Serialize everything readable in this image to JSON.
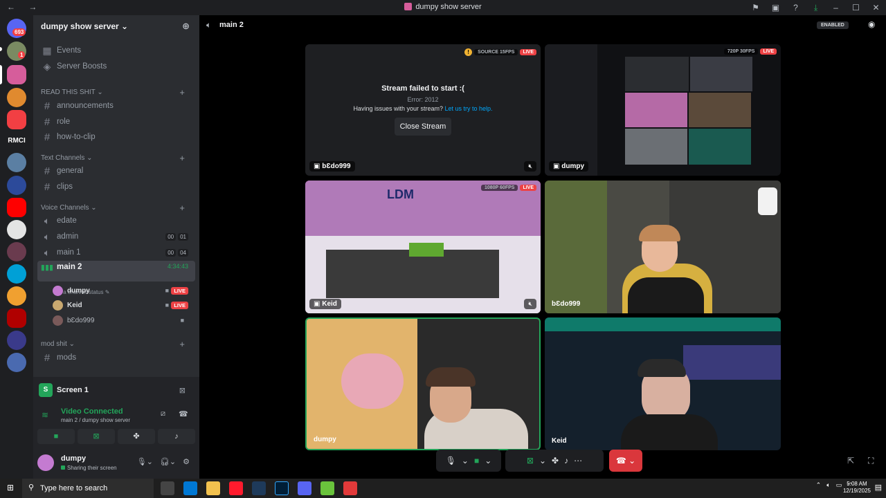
{
  "window": {
    "title": "dumpy show server",
    "nav": "← →"
  },
  "titlebar_icons": [
    "inbox-icon",
    "screen-icon",
    "help-icon",
    "download-icon"
  ],
  "guilds": {
    "home_badge": "693",
    "dm_badge": "1",
    "text_guild": "RMCI"
  },
  "server": {
    "name": "dumpy show server ⌄"
  },
  "sidebar": {
    "top_items": [
      {
        "label": "Events"
      },
      {
        "label": "Server Boosts"
      }
    ],
    "categories": {
      "read": "READ THIS SHIT ⌄",
      "text": "Text Channels ⌄",
      "voice": "Voice Channels ⌄",
      "mod": "mod shit ⌄"
    },
    "read_channels": [
      "announcements",
      "role",
      "how-to-clip"
    ],
    "text_channels": [
      "general",
      "clips"
    ],
    "voice_channels": [
      {
        "name": "edate"
      },
      {
        "name": "admin",
        "counts": [
          "00",
          "01"
        ]
      },
      {
        "name": "main 1",
        "counts": [
          "00",
          "04"
        ]
      },
      {
        "name": "main 2",
        "timer": "4:34:43",
        "status": "Set a channel status"
      }
    ],
    "voice_users": [
      {
        "name": "dumpy",
        "live": "LIVE"
      },
      {
        "name": "Keid",
        "live": "LIVE"
      },
      {
        "name": "bƐdo999",
        "live": ""
      }
    ],
    "mod_channels": [
      "mods"
    ]
  },
  "panel": {
    "screen_label": "Screen 1",
    "connection": "Video Connected",
    "location": "main 2 / dumpy show server",
    "user_name": "dumpy",
    "user_status": "Sharing their screen"
  },
  "main": {
    "channel": "main 2",
    "enabled_badge": "ENABLED",
    "tiles": [
      {
        "name": "bƐdo999",
        "quality": "SOURCE 15FPS",
        "live": "LIVE",
        "error_title": "Stream failed to start :(",
        "error_code": "Error: 2012",
        "error_help": "Having issues with your stream?",
        "error_link": "Let us try to help.",
        "close_label": "Close Stream"
      },
      {
        "name": "dumpy",
        "quality": "720P 30FPS",
        "live": "LIVE"
      },
      {
        "name": "Keid",
        "quality": "1080P 60FPS",
        "live": "LIVE",
        "game_text": "LDM"
      },
      {
        "name": "bƐdo999"
      },
      {
        "name": "dumpy"
      },
      {
        "name": "Keid"
      }
    ]
  },
  "taskbar": {
    "search_placeholder": "Type here to search",
    "time": "5:08 AM",
    "date": "12/19/2025"
  },
  "colors": {
    "accent_green": "#23a55a",
    "live_red": "#ed4245",
    "hangup": "#da373c",
    "sidebar": "#2b2d31",
    "guild_bar": "#1e1f22"
  }
}
